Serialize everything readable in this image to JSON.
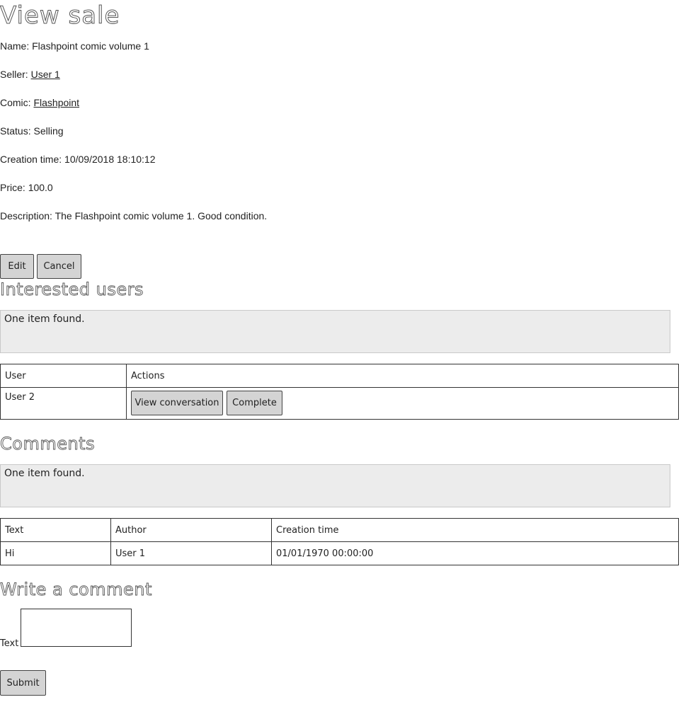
{
  "page": {
    "title": "View sale"
  },
  "sale": {
    "name_label": "Name:",
    "name_value": "Flashpoint comic volume 1",
    "seller_label": "Seller:",
    "seller_value": "User 1",
    "comic_label": "Comic:",
    "comic_value": "Flashpoint",
    "status_label": "Status:",
    "status_value": "Selling",
    "creation_label": "Creation time:",
    "creation_value": "10/09/2018 18:10:12",
    "price_label": "Price:",
    "price_value": "100.0",
    "description_label": "Description:",
    "description_value": "The Flashpoint comic volume 1. Good condition."
  },
  "actions": {
    "edit_label": "Edit",
    "cancel_label": "Cancel"
  },
  "interested": {
    "heading": "Interested users",
    "summary": "One item found.",
    "columns": [
      "User",
      "Actions"
    ],
    "rows": [
      {
        "user": "User 2",
        "view_label": "View conversation",
        "complete_label": "Complete"
      }
    ]
  },
  "comments": {
    "heading": "Comments",
    "summary": "One item found.",
    "columns": [
      "Text",
      "Author",
      "Creation time"
    ],
    "rows": [
      {
        "text": "Hi",
        "author": "User 1",
        "created": "01/01/1970 00:00:00"
      }
    ]
  },
  "write_comment": {
    "heading": "Write a comment",
    "text_label": "Text",
    "text_value": "",
    "submit_label": "Submit"
  }
}
